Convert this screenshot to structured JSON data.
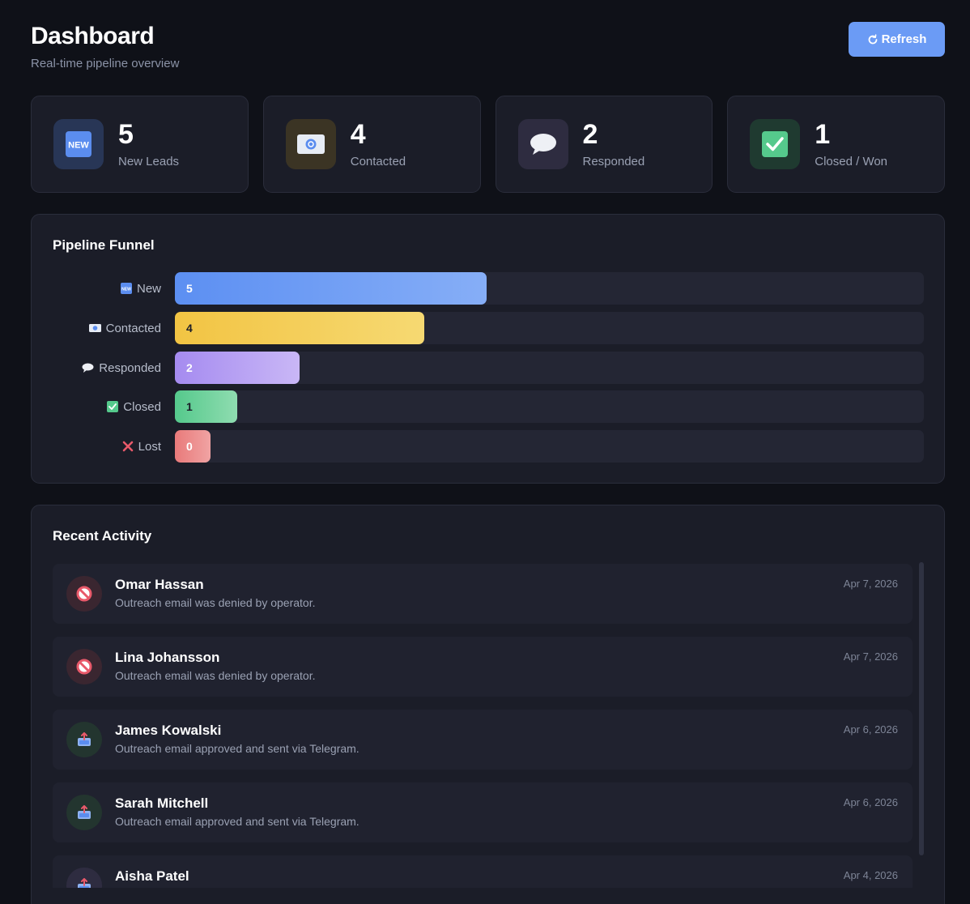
{
  "header": {
    "title": "Dashboard",
    "subtitle": "Real-time pipeline overview",
    "refresh_label": "Refresh",
    "refresh_icon": "refresh-icon"
  },
  "stats": [
    {
      "value": "5",
      "label": "New Leads",
      "icon": "new-badge-icon",
      "color": "#5b8def"
    },
    {
      "value": "4",
      "label": "Contacted",
      "icon": "envelope-icon",
      "color": "#3b3424"
    },
    {
      "value": "2",
      "label": "Responded",
      "icon": "speech-bubble-icon",
      "color": "#2e2c40"
    },
    {
      "value": "1",
      "label": "Closed / Won",
      "icon": "check-mark-icon",
      "color": "#1f3a30"
    }
  ],
  "funnel": {
    "title": "Pipeline Funnel",
    "stages": [
      {
        "label": "New",
        "value": 5,
        "icon": "new-badge-icon",
        "color_from": "#5c8ff2",
        "color_to": "#86aef7",
        "text_color": "#ffffff"
      },
      {
        "label": "Contacted",
        "value": 4,
        "icon": "envelope-icon",
        "color_from": "#f2c443",
        "color_to": "#f6d972",
        "text_color": "#1b1d28"
      },
      {
        "label": "Responded",
        "value": 2,
        "icon": "speech-bubble-icon",
        "color_from": "#a58bf0",
        "color_to": "#c9b7f6",
        "text_color": "#ffffff"
      },
      {
        "label": "Closed",
        "value": 1,
        "icon": "check-mark-icon",
        "color_from": "#55c98c",
        "color_to": "#8fdcb0",
        "text_color": "#1b1d28"
      },
      {
        "label": "Lost",
        "value": 0,
        "icon": "cross-mark-icon",
        "color_from": "#e97a7a",
        "color_to": "#f0a3a3",
        "text_color": "#ffffff"
      }
    ]
  },
  "activity": {
    "title": "Recent Activity",
    "items": [
      {
        "name": "Omar Hassan",
        "desc": "Outreach email was denied by operator.",
        "date": "Apr 7, 2026",
        "icon": "prohibited-icon",
        "avatar_bg": "#3a2630"
      },
      {
        "name": "Lina Johansson",
        "desc": "Outreach email was denied by operator.",
        "date": "Apr 7, 2026",
        "icon": "prohibited-icon",
        "avatar_bg": "#3a2630"
      },
      {
        "name": "James Kowalski",
        "desc": "Outreach email approved and sent via Telegram.",
        "date": "Apr 6, 2026",
        "icon": "outbox-tray-icon",
        "avatar_bg": "#23352f"
      },
      {
        "name": "Sarah Mitchell",
        "desc": "Outreach email approved and sent via Telegram.",
        "date": "Apr 6, 2026",
        "icon": "outbox-tray-icon",
        "avatar_bg": "#23352f"
      },
      {
        "name": "Aisha Patel",
        "desc": "",
        "date": "Apr 4, 2026",
        "icon": "outbox-tray-icon",
        "avatar_bg": "#2e2c40"
      }
    ]
  }
}
